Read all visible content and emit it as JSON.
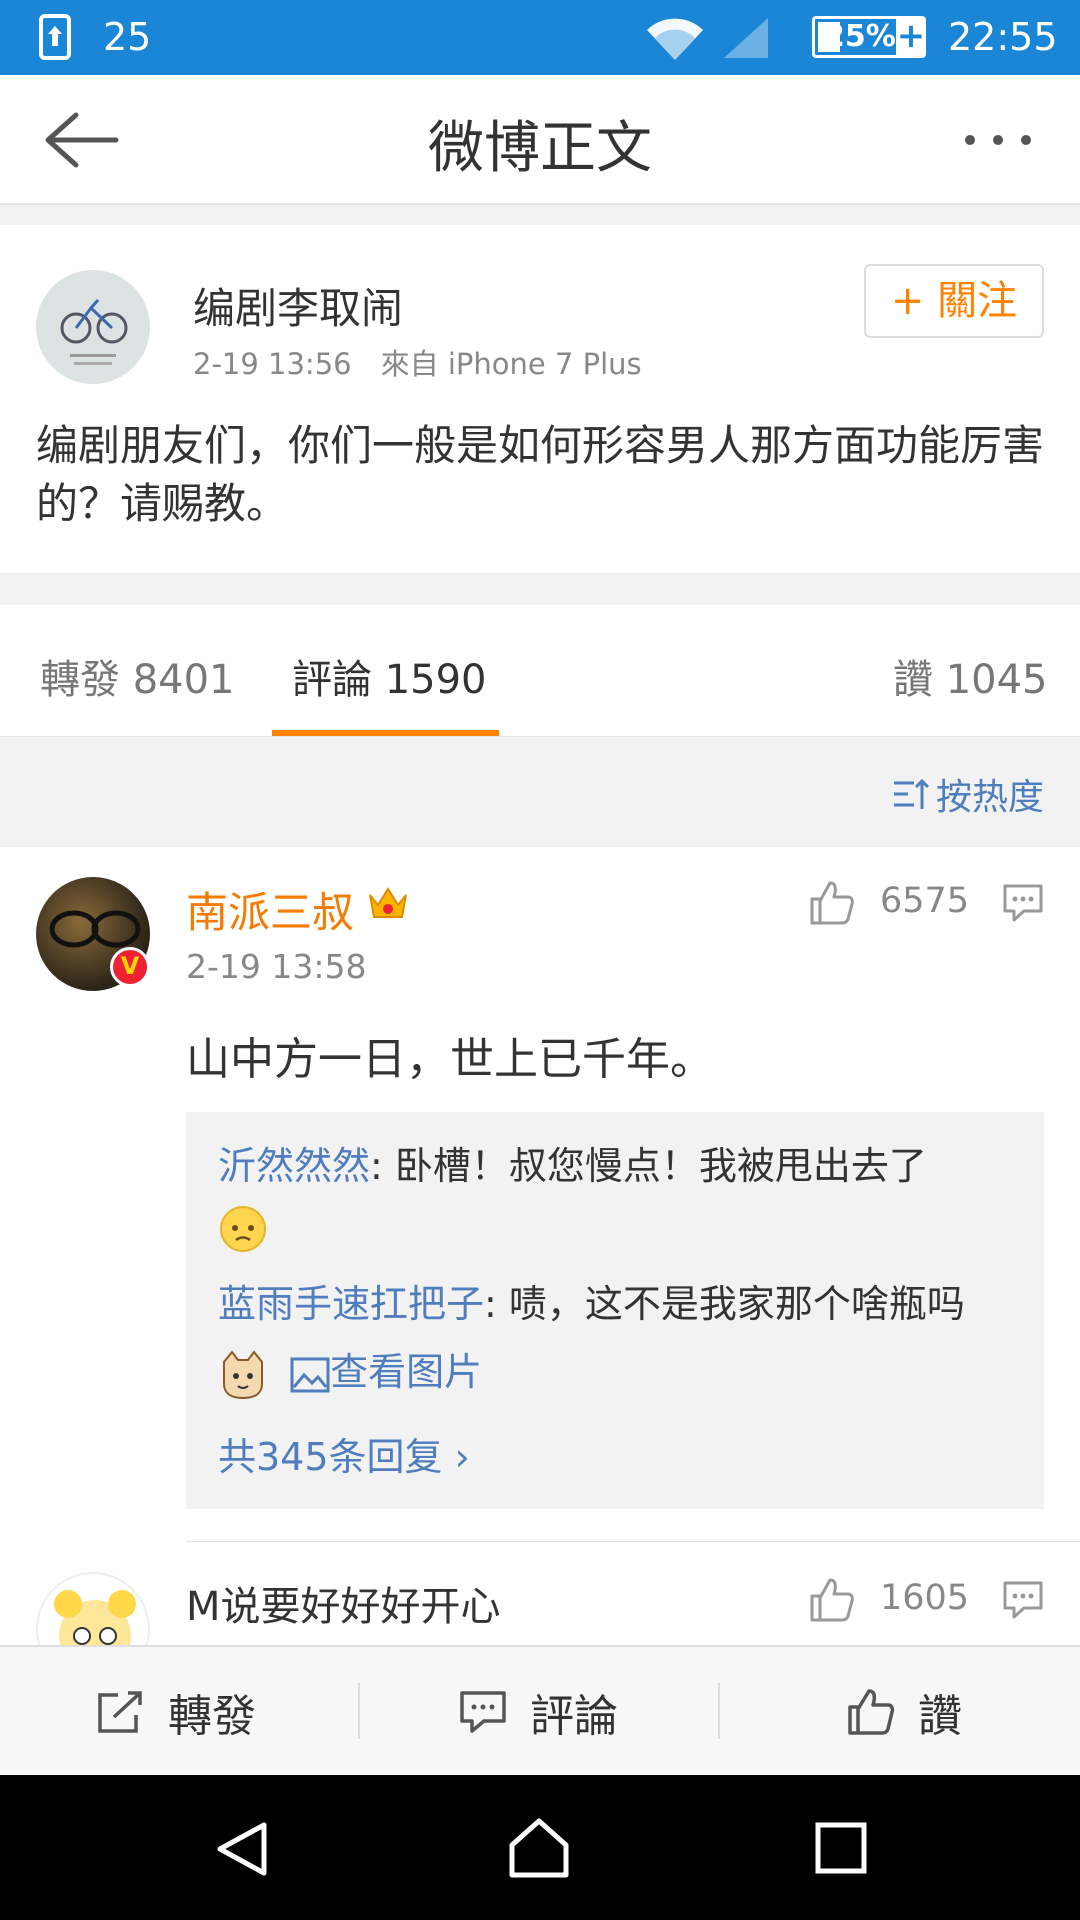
{
  "status_bar": {
    "notification_count": "25",
    "battery": "25%",
    "time": "22:55"
  },
  "header": {
    "title": "微博正文",
    "back_icon": "arrow-left-icon",
    "more_icon": "more-dots-icon"
  },
  "post": {
    "author": "编剧李取闹",
    "meta": "2-19 13:56　來自 iPhone 7 Plus",
    "follow_label": "+ 關注",
    "text": "编剧朋友们，你们一般是如何形容男人那方面功能厉害的？请赐教。"
  },
  "tabs": {
    "repost": "轉發 8401",
    "comment": "評論 1590",
    "like": "讚 1045",
    "accent": "#ff8200"
  },
  "sort": {
    "label": "按热度"
  },
  "comments": [
    {
      "user": "南派三叔",
      "time": "2-19 13:58",
      "likes": "6575",
      "text": "山中方一日，世上已千年。",
      "replies": [
        {
          "user": "沂然然然",
          "text": ": 卧槽！叔您慢点！我被甩出去了"
        },
        {
          "user": "蓝雨手速扛把子",
          "text": ": 啧，这不是我家那个啥瓶吗",
          "image_link": "查看图片"
        }
      ],
      "reply_count": "共345条回复 ›"
    },
    {
      "user": "M说要好好好开心",
      "likes": "1605"
    }
  ],
  "bottom_bar": {
    "repost": "轉發",
    "comment": "評論",
    "like": "讚"
  },
  "colors": {
    "status_bar": "#1b86d6",
    "orange": "#ff8200",
    "link_blue": "#4f7dbd"
  }
}
